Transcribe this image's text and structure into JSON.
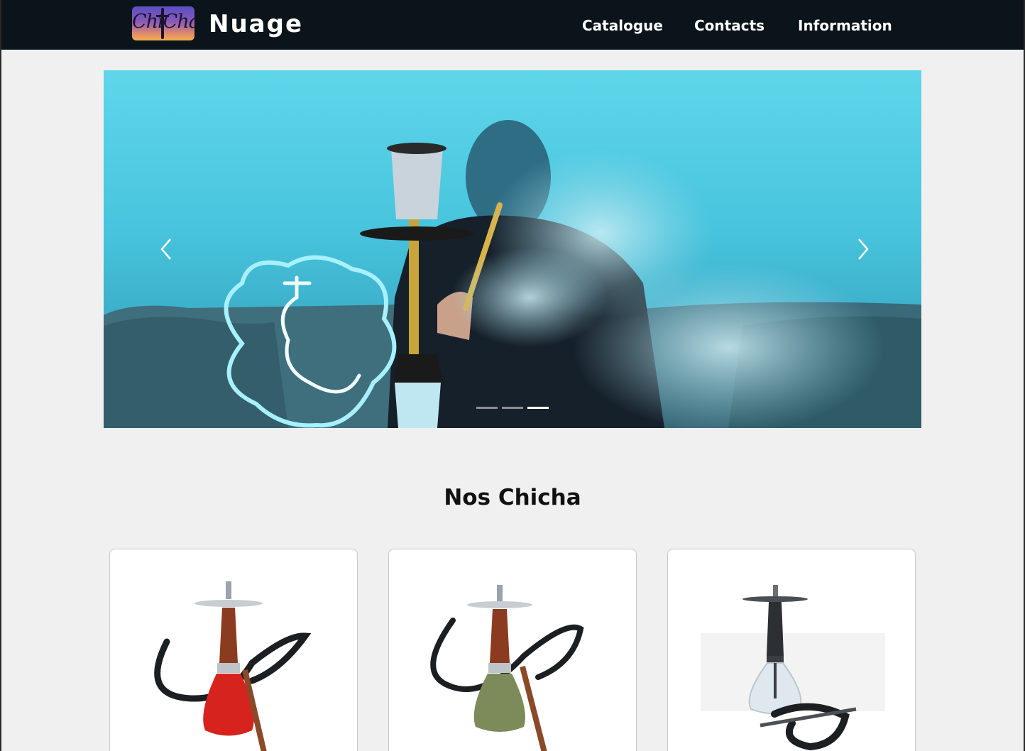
{
  "brand": {
    "logo_text": "ChiCha",
    "name": "Nuage"
  },
  "nav": {
    "items": [
      "Catalogue",
      "Contacts",
      "Information"
    ]
  },
  "carousel": {
    "slide_count": 3,
    "active_slide": 3
  },
  "section": {
    "title": "Nos Chicha"
  },
  "products": [
    {
      "icon": "hookah-red-icon",
      "color": "#d6231e"
    },
    {
      "icon": "hookah-olive-icon",
      "color": "#7d8a5a"
    },
    {
      "icon": "hookah-clear-icon",
      "color": "#dfe8ee"
    }
  ],
  "colors": {
    "navbar": "#0b131b",
    "page_bg": "#f0f0f0",
    "accent": "#47c4dd"
  }
}
